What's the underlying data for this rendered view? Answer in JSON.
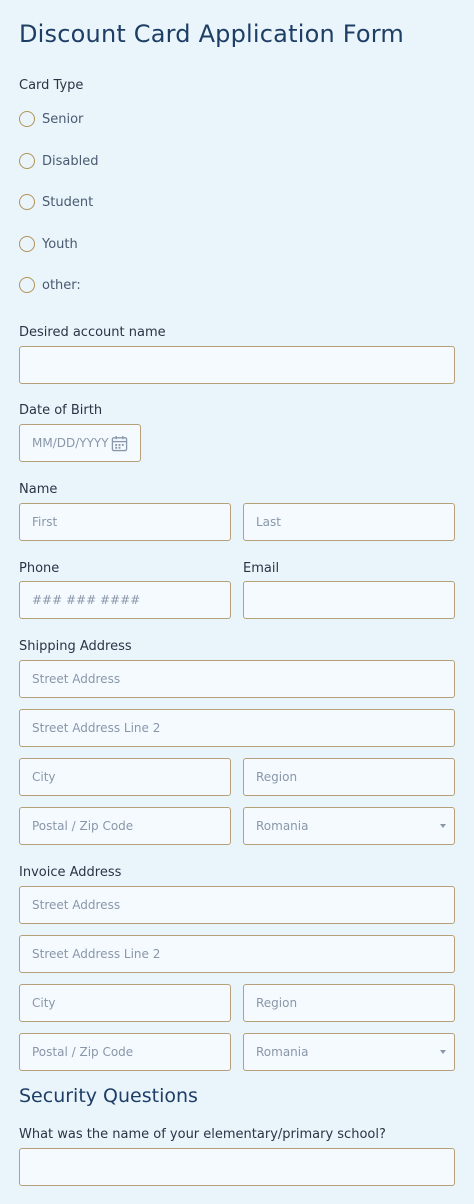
{
  "form": {
    "title": "Discount Card Application Form",
    "card_type": {
      "label": "Card Type",
      "options": [
        "Senior",
        "Disabled",
        "Student",
        "Youth",
        "other:"
      ]
    },
    "account_name": {
      "label": "Desired account name",
      "value": ""
    },
    "dob": {
      "label": "Date of Birth",
      "placeholder": "MM/DD/YYYY"
    },
    "name": {
      "label": "Name",
      "first_placeholder": "First",
      "last_placeholder": "Last"
    },
    "phone": {
      "label": "Phone",
      "placeholder": "### ### ####"
    },
    "email": {
      "label": "Email",
      "value": ""
    },
    "shipping": {
      "label": "Shipping Address",
      "street": "Street Address",
      "street2": "Street Address Line 2",
      "city": "City",
      "region": "Region",
      "postal": "Postal / Zip Code",
      "country": "Romania"
    },
    "invoice": {
      "label": "Invoice Address",
      "street": "Street Address",
      "street2": "Street Address Line 2",
      "city": "City",
      "region": "Region",
      "postal": "Postal / Zip Code",
      "country": "Romania"
    },
    "security": {
      "title": "Security Questions",
      "q1_label": "What was the name of your elementary/primary school?",
      "q1_value": ""
    }
  },
  "colors": {
    "background": "#e9f5fb",
    "field_border": "#b5a07a",
    "title": "#1f3e66"
  },
  "icons": {
    "date_picker": "calendar-icon",
    "country_select": "chevron-down-icon"
  }
}
